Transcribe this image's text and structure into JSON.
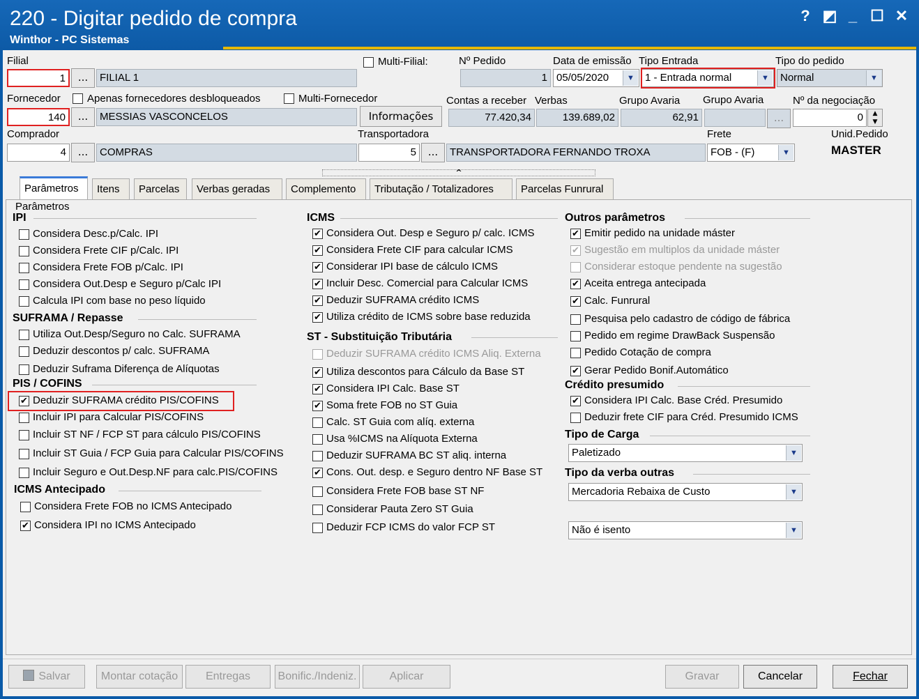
{
  "window": {
    "title": "220 - Digitar pedido de compra",
    "subtitle": "Winthor - PC Sistemas",
    "help_glyph": "?",
    "restore_glyph": "◩",
    "minimize_glyph": "_",
    "maximize_glyph": "☐",
    "close_glyph": "✕"
  },
  "header": {
    "filial_label": "Filial",
    "filial_code": "1",
    "filial_name": "FILIAL 1",
    "multi_filial_label": "Multi-Filial:",
    "nro_pedido_label": "Nº Pedido",
    "nro_pedido": "1",
    "data_emissao_label": "Data de emissão",
    "data_emissao": "05/05/2020",
    "tipo_entrada_label": "Tipo Entrada",
    "tipo_entrada": "1 - Entrada normal",
    "tipo_pedido_label": "Tipo do pedido",
    "tipo_pedido": "Normal",
    "fornecedor_label": "Fornecedor",
    "apenas_desbloqueados_label": "Apenas fornecedores desbloqueados",
    "multi_fornecedor_label": "Multi-Fornecedor",
    "fornecedor_code": "140",
    "fornecedor_name": "MESSIAS VASCONCELOS",
    "informacoes_label": "Informações",
    "contas_receber_label": "Contas a receber",
    "contas_receber": "77.420,34",
    "verbas_label": "Verbas",
    "verbas": "139.689,02",
    "grupo_avaria_label1": "Grupo Avaria",
    "grupo_avaria_value": "62,91",
    "grupo_avaria_label2": "Grupo Avaria",
    "negociacao_label": "Nº da negociação",
    "negociacao": "0",
    "comprador_label": "Comprador",
    "comprador_code": "4",
    "comprador_name": "COMPRAS",
    "transportadora_label": "Transportadora",
    "transportadora_code": "5",
    "transportadora_name": "TRANSPORTADORA FERNANDO TROXA",
    "frete_label": "Frete",
    "frete": "FOB - (F)",
    "unid_pedido_label": "Unid.Pedido",
    "unid_pedido": "MASTER",
    "dots": "...",
    "collapse_glyph": "^"
  },
  "tabs": [
    "Parâmetros",
    "Itens",
    "Parcelas",
    "Verbas geradas",
    "Complemento",
    "Tributação / Totalizadores",
    "Parcelas Funrural"
  ],
  "panel": {
    "group_title": "Parâmetros",
    "ipi_title": "IPI",
    "ipi": [
      {
        "label": "Considera Desc.p/Calc. IPI",
        "checked": false
      },
      {
        "label": "Considera Frete CIF p/Calc. IPI",
        "checked": false
      },
      {
        "label": "Considera Frete FOB p/Calc. IPI",
        "checked": false
      },
      {
        "label": "Considera Out.Desp e Seguro p/Calc IPI",
        "checked": false
      },
      {
        "label": "Calcula IPI com base no peso líquido",
        "checked": false
      }
    ],
    "suframa_title": "SUFRAMA / Repasse",
    "suframa": [
      {
        "label": "Utiliza Out.Desp/Seguro no Calc. SUFRAMA",
        "checked": false
      },
      {
        "label": "Deduzir descontos p/ calc. SUFRAMA",
        "checked": false
      },
      {
        "label": "Deduzir Suframa Diferença de Alíquotas",
        "checked": false
      }
    ],
    "pis_title": "PIS / COFINS",
    "pis": [
      {
        "label": "Deduzir SUFRAMA crédito PIS/COFINS",
        "checked": true
      },
      {
        "label": "Incluir IPI para Calcular PIS/COFINS",
        "checked": false
      },
      {
        "label": "Incluir ST NF / FCP ST para cálculo PIS/COFINS",
        "checked": false
      },
      {
        "label": "Incluir ST Guia / FCP Guia para Calcular PIS/COFINS",
        "checked": false
      },
      {
        "label": "Incluir Seguro e Out.Desp.NF para calc.PIS/COFINS",
        "checked": false
      }
    ],
    "icms_ant_title": "ICMS Antecipado",
    "icms_ant": [
      {
        "label": "Considera Frete FOB no ICMS Antecipado",
        "checked": false
      },
      {
        "label": "Considera IPI no ICMS Antecipado",
        "checked": true
      }
    ],
    "icms_title": "ICMS",
    "icms": [
      {
        "label": "Considera Out. Desp e Seguro p/ calc. ICMS",
        "checked": true
      },
      {
        "label": "Considera Frete CIF para calcular ICMS",
        "checked": true
      },
      {
        "label": "Considerar IPI base de cálculo ICMS",
        "checked": true
      },
      {
        "label": "Incluir Desc. Comercial  para Calcular ICMS",
        "checked": true
      },
      {
        "label": "Deduzir SUFRAMA crédito ICMS",
        "checked": true
      },
      {
        "label": "Utiliza crédito de ICMS sobre base reduzida",
        "checked": true
      }
    ],
    "st_title": "ST - Substituição Tributária",
    "st": [
      {
        "label": "Deduzir SUFRAMA crédito ICMS Aliq. Externa",
        "checked": false,
        "disabled": true
      },
      {
        "label": "Utiliza descontos para Cálculo da Base ST",
        "checked": true
      },
      {
        "label": "Considera IPI Calc. Base ST",
        "checked": true
      },
      {
        "label": "Soma frete FOB no ST Guia",
        "checked": true
      },
      {
        "label": "Calc. ST Guia com alíq. externa",
        "checked": false
      },
      {
        "label": "Usa %ICMS na Alíquota Externa",
        "checked": false
      },
      {
        "label": "Deduzir SUFRAMA BC ST aliq. interna",
        "checked": false
      },
      {
        "label": "Cons. Out. desp. e Seguro dentro NF Base ST",
        "checked": true
      },
      {
        "label": "Considera Frete FOB base ST NF",
        "checked": false
      },
      {
        "label": "Considerar Pauta Zero ST Guia",
        "checked": false
      },
      {
        "label": "Deduzir FCP ICMS do valor FCP ST",
        "checked": false
      }
    ],
    "outros_title": "Outros parâmetros",
    "outros": [
      {
        "label": "Emitir pedido na unidade máster",
        "checked": true
      },
      {
        "label": "Sugestão em multiplos da unidade máster",
        "checked": true,
        "disabled": true
      },
      {
        "label": "Considerar estoque pendente na sugestão",
        "checked": false,
        "disabled": true
      },
      {
        "label": "Aceita entrega antecipada",
        "checked": true
      },
      {
        "label": "Calc. Funrural",
        "checked": true
      },
      {
        "label": "Pesquisa pelo cadastro de código de fábrica",
        "checked": false
      },
      {
        "label": "Pedido em regime DrawBack Suspensão",
        "checked": false
      },
      {
        "label": "Pedido Cotação de compra",
        "checked": false
      },
      {
        "label": "Gerar Pedido Bonif.Automático",
        "checked": true
      }
    ],
    "credito_title": "Crédito presumido",
    "credito": [
      {
        "label": "Considera IPI Calc. Base Créd. Presumido",
        "checked": true
      },
      {
        "label": "Deduzir frete CIF para Créd. Presumido ICMS",
        "checked": false
      }
    ],
    "tipo_carga_title": "Tipo de Carga",
    "tipo_carga": "Paletizado",
    "tipo_verba_title": "Tipo da verba outras",
    "tipo_verba": "Mercadoria Rebaixa de Custo",
    "isencao": "Não é isento",
    "check_glyph": "✔"
  },
  "buttons": {
    "salvar": "Salvar",
    "montar": "Montar cotação",
    "entregas": "Entregas",
    "bonific": "Bonific./Indeniz.",
    "aplicar": "Aplicar",
    "gravar": "Gravar",
    "cancelar": "Cancelar",
    "fechar": "Fechar"
  }
}
